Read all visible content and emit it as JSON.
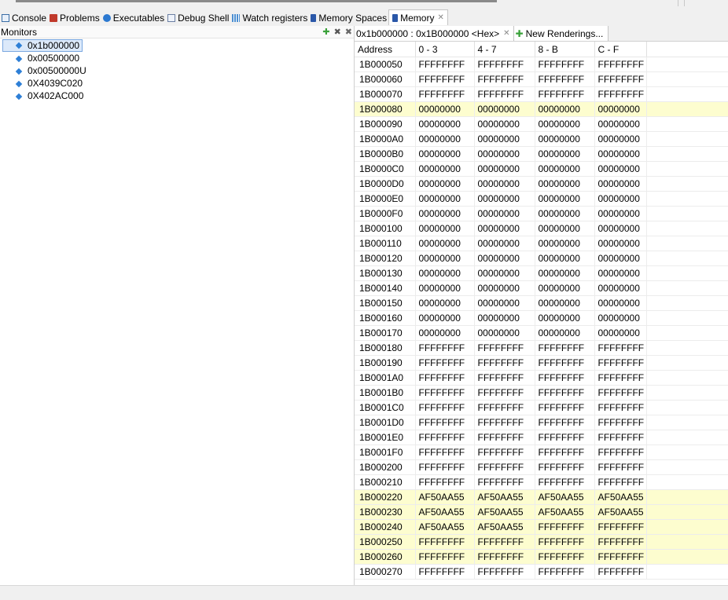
{
  "tabs": [
    {
      "label": "Console",
      "icon": "console-icon",
      "active": false
    },
    {
      "label": "Problems",
      "icon": "problems-icon",
      "active": false
    },
    {
      "label": "Executables",
      "icon": "executables-icon",
      "active": false
    },
    {
      "label": "Debug Shell",
      "icon": "debug-shell-icon",
      "active": false
    },
    {
      "label": "Watch registers",
      "icon": "watch-registers-icon",
      "active": false
    },
    {
      "label": "Memory Spaces",
      "icon": "memory-spaces-icon",
      "active": false
    },
    {
      "label": "Memory",
      "icon": "memory-icon",
      "active": true,
      "close": "✕"
    }
  ],
  "monitors": {
    "title": "Monitors",
    "tools": {
      "add": "✚",
      "remove": "✖",
      "remove_all": "✖"
    },
    "items": [
      "0x1b000000",
      "0x00500000",
      "0x00500000U",
      "0X4039C020",
      "0X402AC000"
    ],
    "selected_index": 0
  },
  "rendering": {
    "tab_label": "0x1b000000 : 0x1B000000 <Hex>",
    "tab_close": "✕",
    "new_label": "New Renderings...",
    "columns": [
      "Address",
      "0 - 3",
      "4 - 7",
      "8 - B",
      "C - F"
    ],
    "rows": [
      {
        "addr": "1B000050",
        "v": [
          "FFFFFFFF",
          "FFFFFFFF",
          "FFFFFFFF",
          "FFFFFFFF"
        ],
        "hl": false
      },
      {
        "addr": "1B000060",
        "v": [
          "FFFFFFFF",
          "FFFFFFFF",
          "FFFFFFFF",
          "FFFFFFFF"
        ],
        "hl": false
      },
      {
        "addr": "1B000070",
        "v": [
          "FFFFFFFF",
          "FFFFFFFF",
          "FFFFFFFF",
          "FFFFFFFF"
        ],
        "hl": false
      },
      {
        "addr": "1B000080",
        "v": [
          "00000000",
          "00000000",
          "00000000",
          "00000000"
        ],
        "hl": true
      },
      {
        "addr": "1B000090",
        "v": [
          "00000000",
          "00000000",
          "00000000",
          "00000000"
        ],
        "hl": false
      },
      {
        "addr": "1B0000A0",
        "v": [
          "00000000",
          "00000000",
          "00000000",
          "00000000"
        ],
        "hl": false
      },
      {
        "addr": "1B0000B0",
        "v": [
          "00000000",
          "00000000",
          "00000000",
          "00000000"
        ],
        "hl": false
      },
      {
        "addr": "1B0000C0",
        "v": [
          "00000000",
          "00000000",
          "00000000",
          "00000000"
        ],
        "hl": false
      },
      {
        "addr": "1B0000D0",
        "v": [
          "00000000",
          "00000000",
          "00000000",
          "00000000"
        ],
        "hl": false
      },
      {
        "addr": "1B0000E0",
        "v": [
          "00000000",
          "00000000",
          "00000000",
          "00000000"
        ],
        "hl": false
      },
      {
        "addr": "1B0000F0",
        "v": [
          "00000000",
          "00000000",
          "00000000",
          "00000000"
        ],
        "hl": false
      },
      {
        "addr": "1B000100",
        "v": [
          "00000000",
          "00000000",
          "00000000",
          "00000000"
        ],
        "hl": false
      },
      {
        "addr": "1B000110",
        "v": [
          "00000000",
          "00000000",
          "00000000",
          "00000000"
        ],
        "hl": false
      },
      {
        "addr": "1B000120",
        "v": [
          "00000000",
          "00000000",
          "00000000",
          "00000000"
        ],
        "hl": false
      },
      {
        "addr": "1B000130",
        "v": [
          "00000000",
          "00000000",
          "00000000",
          "00000000"
        ],
        "hl": false
      },
      {
        "addr": "1B000140",
        "v": [
          "00000000",
          "00000000",
          "00000000",
          "00000000"
        ],
        "hl": false
      },
      {
        "addr": "1B000150",
        "v": [
          "00000000",
          "00000000",
          "00000000",
          "00000000"
        ],
        "hl": false
      },
      {
        "addr": "1B000160",
        "v": [
          "00000000",
          "00000000",
          "00000000",
          "00000000"
        ],
        "hl": false
      },
      {
        "addr": "1B000170",
        "v": [
          "00000000",
          "00000000",
          "00000000",
          "00000000"
        ],
        "hl": false
      },
      {
        "addr": "1B000180",
        "v": [
          "FFFFFFFF",
          "FFFFFFFF",
          "FFFFFFFF",
          "FFFFFFFF"
        ],
        "hl": false
      },
      {
        "addr": "1B000190",
        "v": [
          "FFFFFFFF",
          "FFFFFFFF",
          "FFFFFFFF",
          "FFFFFFFF"
        ],
        "hl": false
      },
      {
        "addr": "1B0001A0",
        "v": [
          "FFFFFFFF",
          "FFFFFFFF",
          "FFFFFFFF",
          "FFFFFFFF"
        ],
        "hl": false
      },
      {
        "addr": "1B0001B0",
        "v": [
          "FFFFFFFF",
          "FFFFFFFF",
          "FFFFFFFF",
          "FFFFFFFF"
        ],
        "hl": false
      },
      {
        "addr": "1B0001C0",
        "v": [
          "FFFFFFFF",
          "FFFFFFFF",
          "FFFFFFFF",
          "FFFFFFFF"
        ],
        "hl": false
      },
      {
        "addr": "1B0001D0",
        "v": [
          "FFFFFFFF",
          "FFFFFFFF",
          "FFFFFFFF",
          "FFFFFFFF"
        ],
        "hl": false
      },
      {
        "addr": "1B0001E0",
        "v": [
          "FFFFFFFF",
          "FFFFFFFF",
          "FFFFFFFF",
          "FFFFFFFF"
        ],
        "hl": false
      },
      {
        "addr": "1B0001F0",
        "v": [
          "FFFFFFFF",
          "FFFFFFFF",
          "FFFFFFFF",
          "FFFFFFFF"
        ],
        "hl": false
      },
      {
        "addr": "1B000200",
        "v": [
          "FFFFFFFF",
          "FFFFFFFF",
          "FFFFFFFF",
          "FFFFFFFF"
        ],
        "hl": false
      },
      {
        "addr": "1B000210",
        "v": [
          "FFFFFFFF",
          "FFFFFFFF",
          "FFFFFFFF",
          "FFFFFFFF"
        ],
        "hl": false
      },
      {
        "addr": "1B000220",
        "v": [
          "AF50AA55",
          "AF50AA55",
          "AF50AA55",
          "AF50AA55"
        ],
        "hl": true
      },
      {
        "addr": "1B000230",
        "v": [
          "AF50AA55",
          "AF50AA55",
          "AF50AA55",
          "AF50AA55"
        ],
        "hl": true
      },
      {
        "addr": "1B000240",
        "v": [
          "AF50AA55",
          "AF50AA55",
          "FFFFFFFF",
          "FFFFFFFF"
        ],
        "hl": true
      },
      {
        "addr": "1B000250",
        "v": [
          "FFFFFFFF",
          "FFFFFFFF",
          "FFFFFFFF",
          "FFFFFFFF"
        ],
        "hl": true
      },
      {
        "addr": "1B000260",
        "v": [
          "FFFFFFFF",
          "FFFFFFFF",
          "FFFFFFFF",
          "FFFFFFFF"
        ],
        "hl": true
      },
      {
        "addr": "1B000270",
        "v": [
          "FFFFFFFF",
          "FFFFFFFF",
          "FFFFFFFF",
          "FFFFFFFF"
        ],
        "hl": false
      }
    ]
  },
  "colors": {
    "highlight": "#fdfdcf",
    "selection": "#dce9fa",
    "accent": "#2e7fd6"
  }
}
